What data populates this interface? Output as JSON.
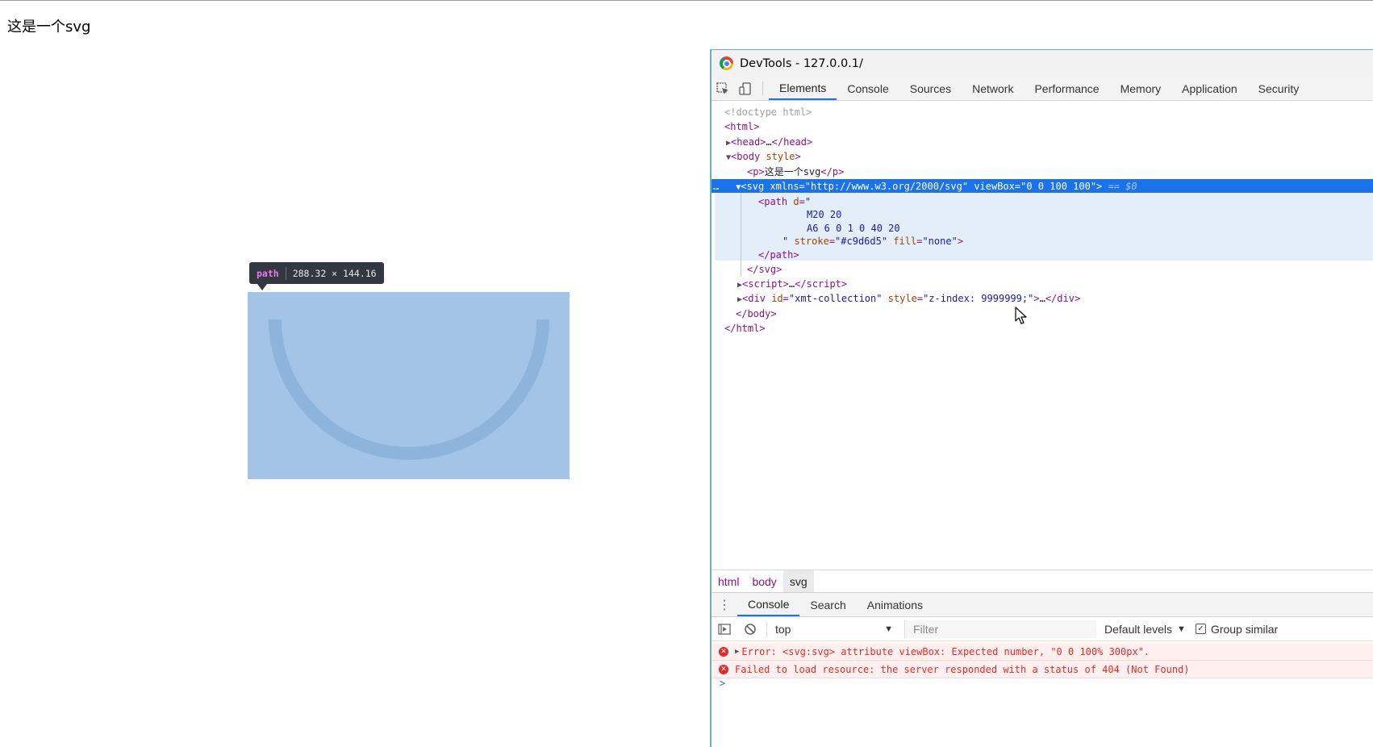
{
  "page": {
    "text": "这是一个svg"
  },
  "highlight": {
    "tag": "path",
    "dims": "288.32 × 144.16",
    "fill": "#a1c4e7",
    "stroke": "#8fb4d9"
  },
  "devtools": {
    "title": "DevTools - 127.0.0.1/",
    "tabs": [
      "Elements",
      "Console",
      "Sources",
      "Network",
      "Performance",
      "Memory",
      "Application",
      "Security"
    ],
    "active_tab": "Elements",
    "dom": {
      "doctype": "<!doctype html>",
      "html_open": "html",
      "head": "head",
      "ellipsis": "…",
      "body": "body",
      "body_attr": "style",
      "p_tag": "p",
      "p_text": "这是一个svg",
      "svg_tag": "svg",
      "svg_xmlns_name": "xmlns",
      "svg_xmlns_value": "\"http://www.w3.org/2000/svg\"",
      "svg_viewbox_name": "viewBox",
      "svg_viewbox_value": "\"0 0 100 100\"",
      "selected_marker": "== $0",
      "path_tag": "path",
      "path_d_name": "d",
      "path_d_line1": "M20 20",
      "path_d_line2": "A6 6 0 1 0 40 20",
      "path_stroke_name": "stroke",
      "path_stroke_value": "\"#c9d6d5\"",
      "path_fill_name": "fill",
      "path_fill_value": "\"none\"",
      "script_tag": "script",
      "div_tag": "div",
      "div_id_name": "id",
      "div_id_value": "\"xmt-collection\"",
      "div_style_name": "style",
      "div_style_value": "\"z-index: 9999999;\""
    },
    "breadcrumbs": [
      "html",
      "body",
      "svg"
    ],
    "drawer_tabs": [
      "Console",
      "Search",
      "Animations"
    ],
    "console": {
      "context": "top",
      "filter_placeholder": "Filter",
      "levels": "Default levels",
      "group_label": "Group similar",
      "group_checked": true,
      "messages": [
        "Error: <svg:svg> attribute viewBox: Expected number, \"0 0 100% 300px\".",
        "Failed to load resource: the server responded with a status of 404 (Not Found)"
      ],
      "prompt": ">"
    }
  },
  "colors": {
    "accent": "#1a73e8",
    "error": "#e5292a",
    "tag": "#881280",
    "attr_name": "#994500",
    "attr_value": "#1a1aa6"
  }
}
